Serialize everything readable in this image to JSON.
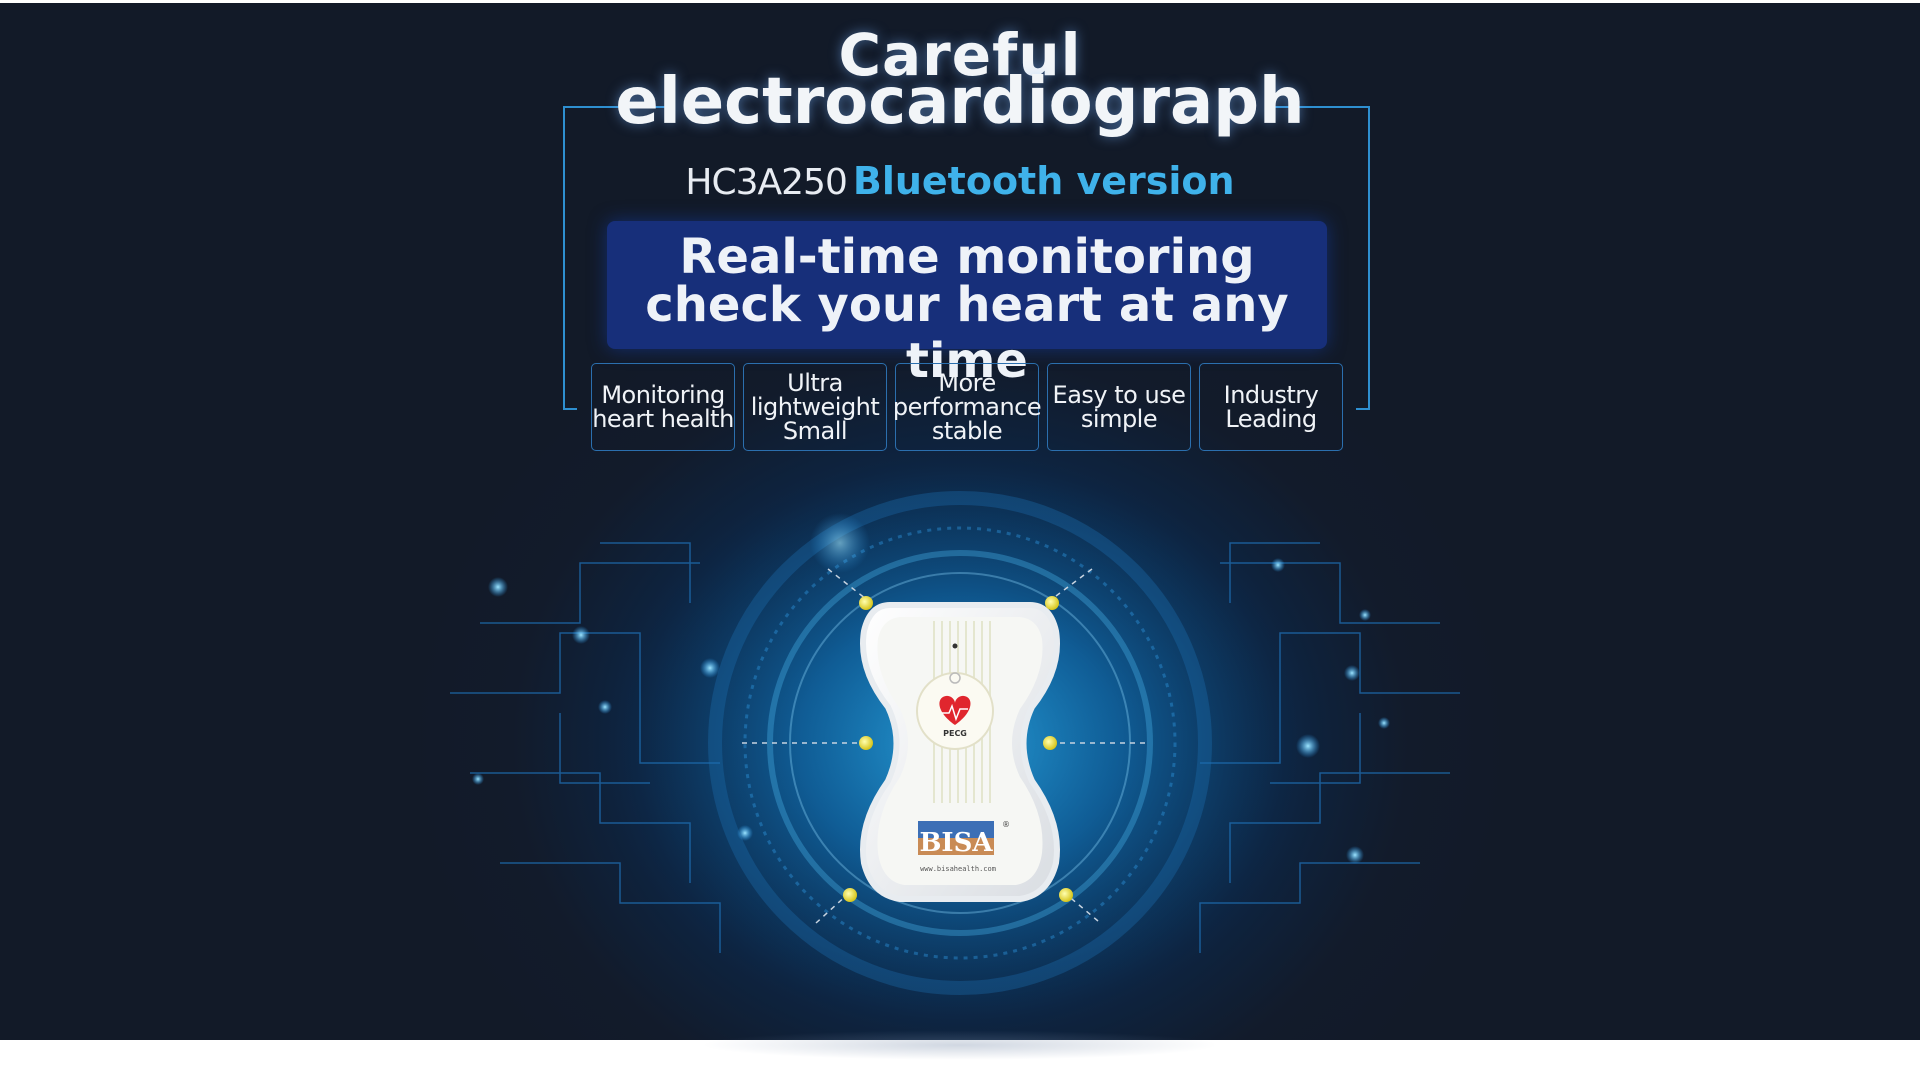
{
  "banner": {
    "title_line1": "Careful",
    "title_line2": "electrocardiograph",
    "model": "HC3A250",
    "version": "Bluetooth version",
    "slogan_line1": "Real-time monitoring",
    "slogan_line2": "check your heart at any time"
  },
  "features": [
    {
      "lines": [
        "Monitoring",
        "heart health"
      ]
    },
    {
      "lines": [
        "Ultra",
        "lightweight",
        "Small"
      ]
    },
    {
      "lines": [
        "More",
        "performance",
        "stable"
      ]
    },
    {
      "lines": [
        "Easy to use",
        "simple"
      ]
    },
    {
      "lines": [
        "Industry",
        "Leading"
      ]
    }
  ],
  "device": {
    "logo_text": "BISA",
    "badge_text": "PECG",
    "website": "www.bisahealth.com"
  },
  "colors": {
    "background": "#121a28",
    "accent_blue": "#3fb2ea",
    "slogan_box": "#172f7a",
    "frame_line": "#2e8fd0"
  }
}
